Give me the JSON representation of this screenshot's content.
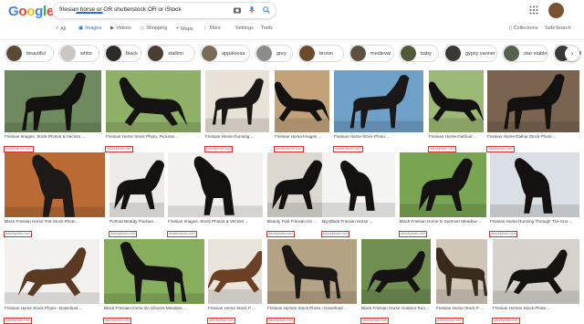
{
  "header": {
    "logo_letters": [
      {
        "ch": "G",
        "color": "#4285f4"
      },
      {
        "ch": "o",
        "color": "#ea4335"
      },
      {
        "ch": "o",
        "color": "#fbbc05"
      },
      {
        "ch": "g",
        "color": "#4285f4"
      },
      {
        "ch": "l",
        "color": "#34a853"
      },
      {
        "ch": "e",
        "color": "#ea4335"
      }
    ],
    "search_query": "friesian horse or OR shutterstock OR or iStock",
    "icons": [
      "camera-icon",
      "mic-icon",
      "search-icon"
    ],
    "apps_icon": "apps-grid-icon"
  },
  "tabs": [
    {
      "label": "All",
      "icon": "search-icon",
      "active": false
    },
    {
      "label": "Images",
      "icon": "image-icon",
      "active": true
    },
    {
      "label": "Videos",
      "icon": "video-icon",
      "active": false
    },
    {
      "label": "Shopping",
      "icon": "tag-icon",
      "active": false
    },
    {
      "label": "Maps",
      "icon": "pin-icon",
      "active": false
    },
    {
      "label": "More",
      "icon": "more-icon",
      "active": false
    }
  ],
  "tools": {
    "settings": "Settings",
    "tools": "Tools"
  },
  "right_links": {
    "collections": "Collections",
    "safesearch": "SafeSearch"
  },
  "chips": [
    {
      "label": "beautiful",
      "color": "#5b4a3a"
    },
    {
      "label": "white",
      "color": "#c9c7c2"
    },
    {
      "label": "black",
      "color": "#2e2a27"
    },
    {
      "label": "stallion",
      "color": "#4a3e33"
    },
    {
      "label": "appaloosa",
      "color": "#7b6a55"
    },
    {
      "label": "grey",
      "color": "#8e8c88"
    },
    {
      "label": "brown",
      "color": "#6e4a2c"
    },
    {
      "label": "medieval",
      "color": "#5e5040"
    },
    {
      "label": "baby",
      "color": "#4f5b3a"
    },
    {
      "label": "gypsy vanner",
      "color": "#3d3833"
    },
    {
      "label": "star stable",
      "color": "#55614a"
    },
    {
      "label": "fell",
      "color": "#3a3836"
    }
  ],
  "results": [
    {
      "caption": "Friesian Images, Stock Photos & Vectors ...",
      "source": "shutterstock.com",
      "bg": "#6f8a5e",
      "horse": "#141210"
    },
    {
      "caption": "Friesian Horse Stock Photo, Pictures ...",
      "source": "istockphoto.com",
      "bg": "#8fb067",
      "horse": "#161412"
    },
    {
      "caption": "Friesian Horse Running ...",
      "source": "istockphoto.com",
      "bg": "#e7e1d6",
      "horse": "#1a1816"
    },
    {
      "caption": "Friesian Horse Images ...",
      "source": "shutterstock.com",
      "bg": "#c3a27a",
      "horse": "#141210"
    },
    {
      "caption": "Friesian Horse Stock Photo ...",
      "source": "shutterstock.com",
      "bg": "#6fa0c8",
      "horse": "#1a1816"
    },
    {
      "caption": "Friesian Horse Outdoor ...",
      "source": "istockphoto.com",
      "bg": "#9bb874",
      "horse": "#141210"
    },
    {
      "caption": "Friesian Horse Gallop Stock Photo ...",
      "source": "istockphoto.com",
      "bg": "#7a6450",
      "horse": "#141210"
    },
    {
      "caption": "Black Friesian Horse Trot Stock Photo ...",
      "source": "istockphoto.com",
      "bg": "#b96a35",
      "horse": "#1e1a17"
    },
    {
      "caption": "Portrait Beauty Friesian ...",
      "source": "istockphoto.com",
      "bg": "#ecebe8",
      "horse": "#141210"
    },
    {
      "caption": "Friesian Images, Stock Photos & Vectors ...",
      "source": "shutterstock.com",
      "bg": "#f2f1ee",
      "horse": "#141210"
    },
    {
      "caption": "Beauty Fval Friesian Ho ...",
      "source": "istockphoto.com",
      "bg": "#dcd7cf",
      "horse": "#141210"
    },
    {
      "caption": "Big Black Friesian Horse ...",
      "source": "istockphoto.com",
      "bg": "#f4f4f2",
      "horse": "#141210"
    },
    {
      "caption": "Black Friesian Horse In Summer Meadow ...",
      "source": "istockphoto.com",
      "bg": "#79a452",
      "horse": "#161412"
    },
    {
      "caption": "Friesian Horse Running Through The Sno ...",
      "source": "istockphoto.com",
      "bg": "#d9dfe4",
      "horse": "#141210"
    },
    {
      "caption": "Friesian Horse Stock Photo - Download ...",
      "source": "istockphoto.com",
      "bg": "#f3f1ee",
      "horse": "#5a3a22"
    },
    {
      "caption": "Black Friesian Horse On Clovers Meadow ...",
      "source": "istockphoto.com",
      "bg": "#86ae5c",
      "horse": "#161412"
    },
    {
      "caption": "Friesian Horse Stock P ...",
      "source": "istockphoto.com",
      "bg": "#e9e4dc",
      "horse": "#6b4025"
    },
    {
      "caption": "Friesian Horses Stock Photo - Download ...",
      "source": "istockphoto.com",
      "bg": "#b3a284",
      "horse": "#1c1917"
    },
    {
      "caption": "Black Friesian Horse Outdoor Running ...",
      "source": "istockphoto.com",
      "bg": "#6f8e50",
      "horse": "#161412"
    },
    {
      "caption": "Friesian Horse Stock P ...",
      "source": "istockphoto.com",
      "bg": "#cfc6b8",
      "horse": "#3a2a1e"
    },
    {
      "caption": "Friesian Horses Stock Photo ...",
      "source": "istockphoto.com",
      "bg": "#d6d2cb",
      "horse": "#161412"
    }
  ]
}
